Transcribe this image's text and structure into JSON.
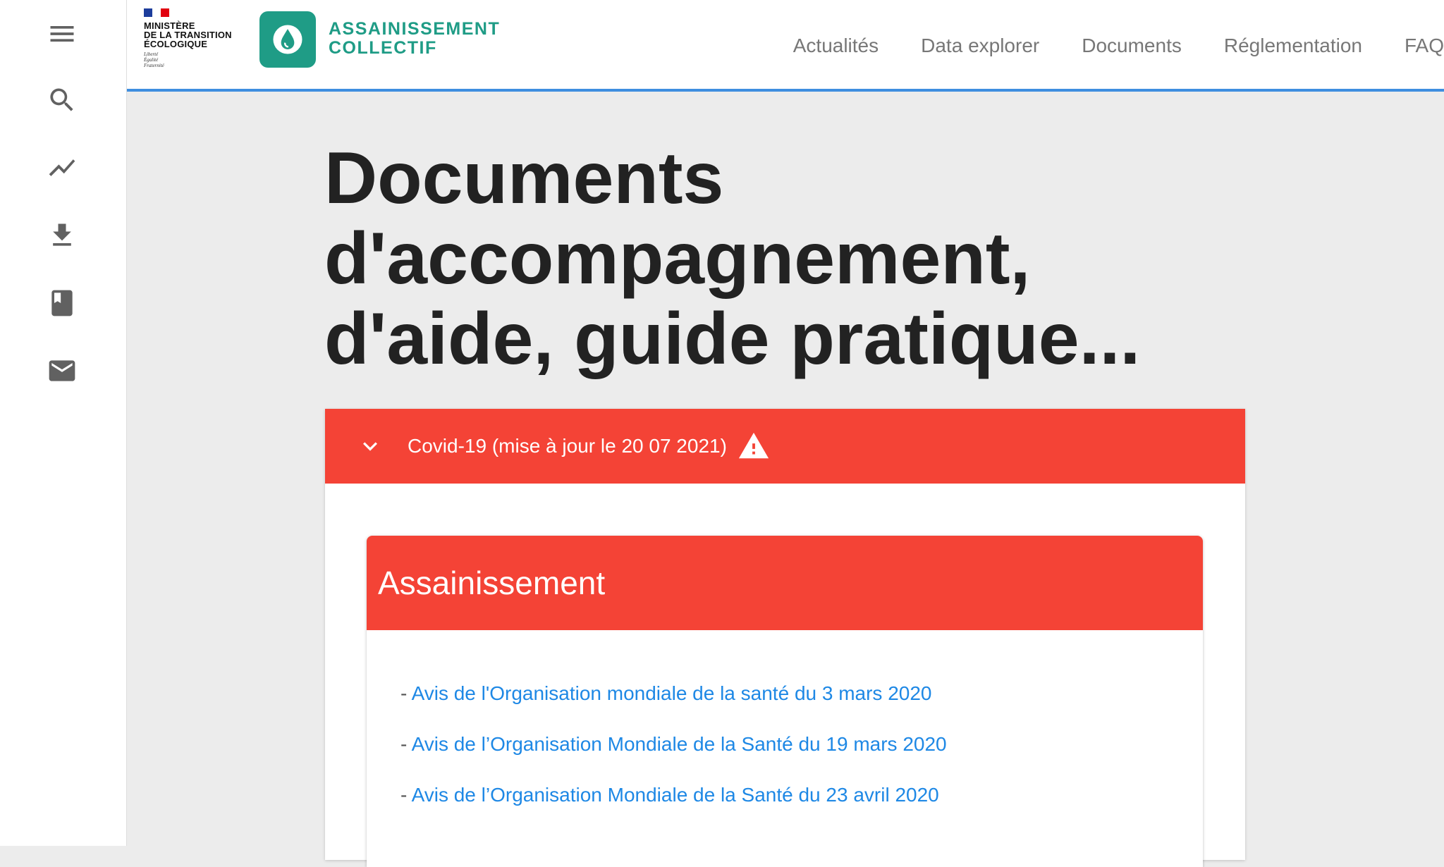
{
  "rail": {
    "icons": [
      "menu-icon",
      "search-icon",
      "trending-icon",
      "download-icon",
      "book-icon",
      "mail-icon"
    ]
  },
  "header": {
    "ministry": {
      "name": "MINISTÈRE\nDE LA TRANSITION\nÉCOLOGIQUE",
      "motto": "Liberté\nÉgalité\nFraternité"
    },
    "app_name_line1": "ASSAINISSEMENT",
    "app_name_line2": "COLLECTIF",
    "nav": [
      "Actualités",
      "Data explorer",
      "Documents",
      "Réglementation",
      "FAQ"
    ]
  },
  "main": {
    "title": "Documents d'accompagnement, d'aide, guide pratique...",
    "panel": {
      "title": "Covid-19 (mise à jour le 20 07 2021)",
      "card": {
        "title": "Assainissement",
        "items": [
          {
            "prefix": "- ",
            "link": "Avis de l'Organisation mondiale de la santé du 3 mars 2020"
          },
          {
            "prefix": "- ",
            "link": "Avis de l’Organisation Mondiale de la Santé du 19 mars 2020"
          },
          {
            "prefix": "- ",
            "link": "Avis de l’Organisation Mondiale de la Santé du 23 avril 2020"
          }
        ]
      }
    }
  },
  "colors": {
    "accent_red": "#f44336",
    "brand_teal": "#1f9c86",
    "link_blue": "#1e88e5",
    "header_border": "#3f8ee0"
  }
}
